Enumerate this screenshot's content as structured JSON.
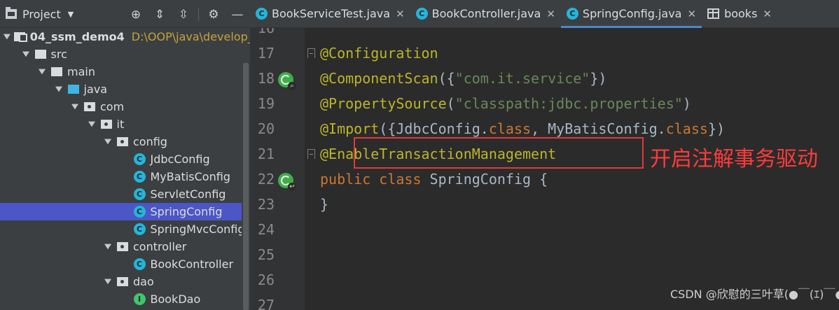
{
  "project_panel": {
    "title": "Project",
    "tree": [
      {
        "label": "04_ssm_demo4",
        "path": "D:\\OOP\\java\\develop_ide",
        "kind": "module",
        "depth": 0
      },
      {
        "label": "src",
        "kind": "folder",
        "depth": 1
      },
      {
        "label": "main",
        "kind": "folder",
        "depth": 2
      },
      {
        "label": "java",
        "kind": "source-folder",
        "depth": 3
      },
      {
        "label": "com",
        "kind": "package",
        "depth": 4
      },
      {
        "label": "it",
        "kind": "package",
        "depth": 5
      },
      {
        "label": "config",
        "kind": "package",
        "depth": 6
      },
      {
        "label": "JdbcConfig",
        "kind": "class",
        "depth": 7
      },
      {
        "label": "MyBatisConfig",
        "kind": "class",
        "depth": 7
      },
      {
        "label": "ServletConfig",
        "kind": "class",
        "depth": 7
      },
      {
        "label": "SpringConfig",
        "kind": "class",
        "depth": 7,
        "selected": true
      },
      {
        "label": "SpringMvcConfig",
        "kind": "class",
        "depth": 7
      },
      {
        "label": "controller",
        "kind": "package",
        "depth": 6
      },
      {
        "label": "BookController",
        "kind": "class",
        "depth": 7
      },
      {
        "label": "dao",
        "kind": "package",
        "depth": 6
      },
      {
        "label": "BookDao",
        "kind": "interface",
        "depth": 7
      }
    ]
  },
  "tabs": [
    {
      "label": "BookServiceTest.java",
      "icon": "test-class-icon",
      "active": false
    },
    {
      "label": "BookController.java",
      "icon": "class-icon",
      "active": false
    },
    {
      "label": "SpringConfig.java",
      "icon": "class-icon",
      "active": true
    },
    {
      "label": "books",
      "icon": "table-icon",
      "active": false
    }
  ],
  "editor": {
    "partial_line_number": "16",
    "lines": [
      {
        "number": "17",
        "tokens": [
          {
            "t": "@Configuration",
            "c": "ann"
          }
        ]
      },
      {
        "number": "18",
        "tokens": [
          {
            "t": "@ComponentScan",
            "c": "ann"
          },
          {
            "t": "({",
            "c": "id"
          },
          {
            "t": "\"com.it.service\"",
            "c": "str"
          },
          {
            "t": "})",
            "c": "id"
          }
        ]
      },
      {
        "number": "19",
        "tokens": [
          {
            "t": "@PropertySource",
            "c": "ann"
          },
          {
            "t": "(",
            "c": "id"
          },
          {
            "t": "\"classpath:jdbc.properties\"",
            "c": "str"
          },
          {
            "t": ")",
            "c": "id"
          }
        ]
      },
      {
        "number": "20",
        "tokens": [
          {
            "t": "@Import",
            "c": "ann"
          },
          {
            "t": "({JdbcConfig.",
            "c": "id"
          },
          {
            "t": "class",
            "c": "kw"
          },
          {
            "t": ", MyBatisConfig.",
            "c": "id"
          },
          {
            "t": "class",
            "c": "kw"
          },
          {
            "t": "})",
            "c": "id"
          }
        ]
      },
      {
        "number": "21",
        "tokens": [
          {
            "t": "@EnableTransactionManagement",
            "c": "ann"
          }
        ]
      },
      {
        "number": "22",
        "tokens": [
          {
            "t": "public class ",
            "c": "kw"
          },
          {
            "t": "SpringConfig {",
            "c": "id"
          }
        ]
      },
      {
        "number": "23",
        "tokens": [
          {
            "t": "}",
            "c": "id"
          }
        ]
      },
      {
        "number": "24",
        "tokens": []
      },
      {
        "number": "25",
        "tokens": []
      },
      {
        "number": "26",
        "tokens": []
      },
      {
        "number": "27",
        "tokens": []
      }
    ]
  },
  "annotation_note": "开启注解事务驱动",
  "watermark": "CSDN @欣慰的三叶草(●￣(ｴ)￣●)",
  "colors": {
    "annotation": "#bbb529",
    "string": "#6a8759",
    "keyword": "#cc7832",
    "identifier": "#a9b7c6",
    "selection": "#4b56c7",
    "highlight_box": "#e03a3a",
    "note_text": "#ff3b3b"
  }
}
